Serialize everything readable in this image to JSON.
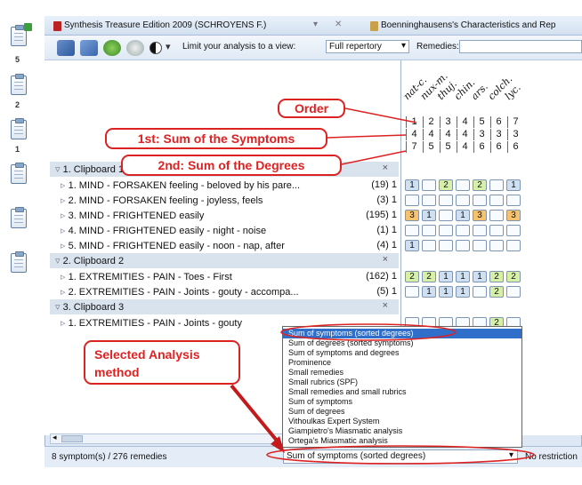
{
  "left_toolbar": {
    "counts": [
      "5",
      "2",
      "1"
    ]
  },
  "tabs": [
    {
      "label": "Synthesis Treasure Edition 2009 (SCHROYENS F.)"
    },
    {
      "label": "Boenninghausens's Characteristics and Rep"
    }
  ],
  "toolbar": {
    "limit_label": "Limit your analysis to a view:",
    "limit_value": "Full repertory",
    "remedies_label": "Remedies:"
  },
  "remedies": [
    "nat-c.",
    "nux-m.",
    "thuj.",
    "chin.",
    "ars.",
    "colch.",
    "lyc."
  ],
  "order": [
    "1",
    "2",
    "3",
    "4",
    "5",
    "6",
    "7"
  ],
  "sum_symptoms": [
    "4",
    "4",
    "4",
    "4",
    "3",
    "3",
    "3"
  ],
  "sum_degrees": [
    "7",
    "5",
    "5",
    "4",
    "6",
    "6",
    "6"
  ],
  "callouts": {
    "order": "Order",
    "first": "1st: Sum of the Symptoms",
    "second": "2nd: Sum of the Degrees",
    "selected": "Selected Analysis method"
  },
  "clipboards": [
    {
      "label": "1. Clipboard 1",
      "rows": [
        {
          "text": "1. MIND - FORSAKEN feeling - beloved by his pare...",
          "count": "(19) 1",
          "cells": [
            1,
            0,
            2,
            0,
            2,
            0,
            1
          ]
        },
        {
          "text": "2. MIND - FORSAKEN feeling - joyless, feels",
          "count": "(3) 1",
          "cells": [
            0,
            0,
            0,
            0,
            0,
            0,
            0
          ]
        },
        {
          "text": "3. MIND - FRIGHTENED easily",
          "count": "(195) 1",
          "cells": [
            3,
            1,
            0,
            1,
            3,
            0,
            3
          ]
        },
        {
          "text": "4. MIND - FRIGHTENED easily - night - noise",
          "count": "(1) 1",
          "cells": [
            0,
            0,
            0,
            0,
            0,
            0,
            0
          ]
        },
        {
          "text": "5. MIND - FRIGHTENED easily - noon - nap, after",
          "count": "(4) 1",
          "cells": [
            1,
            0,
            0,
            0,
            0,
            0,
            0
          ]
        }
      ]
    },
    {
      "label": "2. Clipboard 2",
      "rows": [
        {
          "text": "1. EXTREMITIES - PAIN - Toes - First",
          "count": "(162) 1",
          "cells": [
            2,
            2,
            1,
            1,
            1,
            2,
            2
          ]
        },
        {
          "text": "2. EXTREMITIES - PAIN - Joints - gouty - accompa...",
          "count": "(5) 1",
          "cells": [
            0,
            1,
            1,
            1,
            0,
            2,
            0
          ]
        }
      ]
    },
    {
      "label": "3. Clipboard 3",
      "rows": [
        {
          "text": "1. EXTREMITIES - PAIN - Joints - gouty",
          "count": "",
          "cells": [
            0,
            0,
            0,
            0,
            0,
            2,
            0
          ]
        }
      ]
    }
  ],
  "dropdown": {
    "options": [
      "Sum of symptoms (sorted degrees)",
      "Sum of degrees (sorted symptoms)",
      "Sum of symptoms and degrees",
      "Prominence",
      "Small remedies",
      "Small rubrics (SPF)",
      "Small remedies and small rubrics",
      "Sum of symptoms",
      "Sum of degrees",
      "Vithoulkas Expert System",
      "Giampietro's Miasmatic analysis",
      "Ortega's Miasmatic analysis"
    ],
    "selected_index": 0,
    "current_value": "Sum of symptoms (sorted degrees)"
  },
  "status": {
    "summary": "8 symptom(s) / 276 remedies",
    "restriction": "No restriction"
  },
  "colors": {
    "accent": "#d22222",
    "selection": "#2f6fc9",
    "grade1": "#cfe0f3",
    "grade2": "#d6f0a8",
    "grade3": "#f6c26b"
  }
}
